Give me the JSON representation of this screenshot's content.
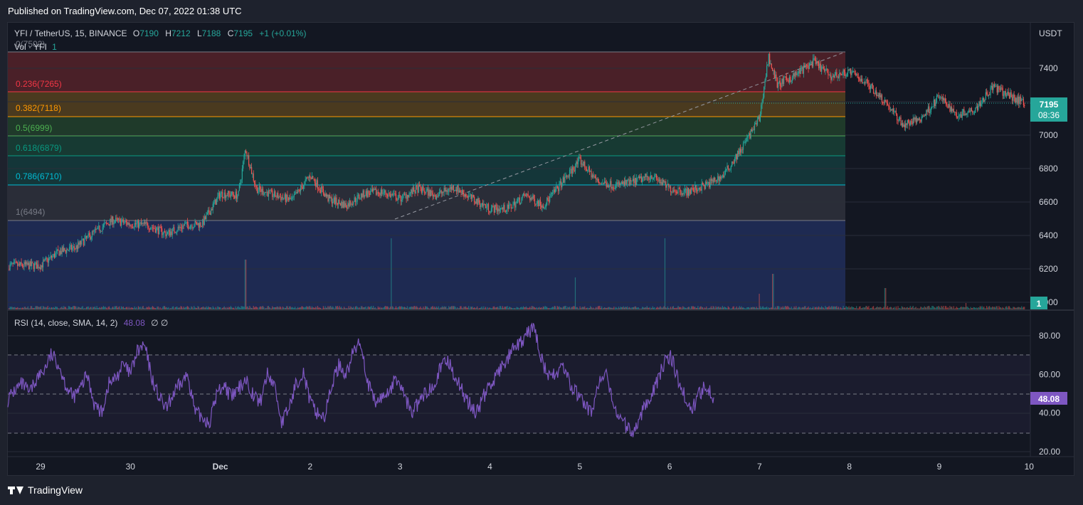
{
  "header": {
    "published_text": "Published on TradingView.com, Dec 07, 2022 01:38 UTC"
  },
  "legend": {
    "symbol": "YFI / TetherUS, 15, BINANCE",
    "o_label": "O",
    "o_value": "7190",
    "h_label": "H",
    "h_value": "7212",
    "l_label": "L",
    "l_value": "7188",
    "c_label": "C",
    "c_value": "7195",
    "change": "+1 (+0.01%)",
    "vol_label": "Vol · YFI",
    "vol_value": "1"
  },
  "price_axis": {
    "currency": "USDT",
    "ticks": [
      "7400",
      "7200",
      "7000",
      "6800",
      "6600",
      "6400",
      "6200",
      "6000"
    ],
    "last_price": "7195",
    "countdown": "08:36",
    "vol_badge": "1"
  },
  "rsi_panel": {
    "label": "RSI (14, close, SMA, 14, 2)",
    "value": "48.08",
    "extra": "∅ ∅",
    "ticks": [
      "80.00",
      "60.00",
      "40.00",
      "20.00"
    ],
    "badge": "48.08"
  },
  "time_axis": {
    "labels": [
      "29",
      "30",
      "Dec",
      "2",
      "3",
      "4",
      "5",
      "6",
      "7",
      "8",
      "9",
      "10"
    ]
  },
  "footer": {
    "brand": "TradingView"
  },
  "colors": {
    "up": "#26a69a",
    "down": "#ef5350",
    "rsi": "#7e57c2",
    "background": "#131722"
  },
  "chart_data": [
    {
      "type": "candlestick",
      "title": "YFI / TetherUS, 15, BINANCE",
      "x_labels": [
        "29",
        "30",
        "Dec",
        "2",
        "3",
        "4",
        "5",
        "6",
        "7",
        "8",
        "9",
        "10"
      ],
      "ylim": [
        6050,
        7520
      ],
      "y_ticks": [
        6200,
        6400,
        6600,
        6800,
        7000,
        7200,
        7400
      ],
      "fib_levels": [
        {
          "label": "0(7502)",
          "ratio": 0,
          "price": 7502,
          "color": "#787b86"
        },
        {
          "label": "0.236(7265)",
          "ratio": 0.236,
          "price": 7265,
          "color": "#f23645"
        },
        {
          "label": "0.382(7118)",
          "ratio": 0.382,
          "price": 7118,
          "color": "#ff9800"
        },
        {
          "label": "0.5(6999)",
          "ratio": 0.5,
          "price": 6999,
          "color": "#4caf50"
        },
        {
          "label": "0.618(6879)",
          "ratio": 0.618,
          "price": 6879,
          "color": "#089981"
        },
        {
          "label": "0.786(6710)",
          "ratio": 0.786,
          "price": 6710,
          "color": "#00bcd4"
        },
        {
          "label": "1(6494)",
          "ratio": 1,
          "price": 6494,
          "color": "#787b86"
        }
      ],
      "price_path": [
        {
          "t": 0.0,
          "p": 6220
        },
        {
          "t": 0.2,
          "p": 6300
        },
        {
          "t": 0.4,
          "p": 6330
        },
        {
          "t": 0.6,
          "p": 6420
        },
        {
          "t": 0.8,
          "p": 6490
        },
        {
          "t": 1.0,
          "p": 6470
        },
        {
          "t": 1.2,
          "p": 6460
        },
        {
          "t": 1.4,
          "p": 6410
        },
        {
          "t": 1.6,
          "p": 6460
        },
        {
          "t": 1.8,
          "p": 6470
        },
        {
          "t": 2.0,
          "p": 6650
        },
        {
          "t": 2.2,
          "p": 6640
        },
        {
          "t": 2.28,
          "p": 6920
        },
        {
          "t": 2.4,
          "p": 6680
        },
        {
          "t": 2.6,
          "p": 6640
        },
        {
          "t": 2.8,
          "p": 6610
        },
        {
          "t": 3.0,
          "p": 6760
        },
        {
          "t": 3.2,
          "p": 6620
        },
        {
          "t": 3.4,
          "p": 6580
        },
        {
          "t": 3.6,
          "p": 6650
        },
        {
          "t": 3.8,
          "p": 6660
        },
        {
          "t": 4.0,
          "p": 6620
        },
        {
          "t": 4.2,
          "p": 6680
        },
        {
          "t": 4.4,
          "p": 6640
        },
        {
          "t": 4.6,
          "p": 6690
        },
        {
          "t": 4.8,
          "p": 6620
        },
        {
          "t": 5.0,
          "p": 6560
        },
        {
          "t": 5.2,
          "p": 6560
        },
        {
          "t": 5.4,
          "p": 6640
        },
        {
          "t": 5.6,
          "p": 6580
        },
        {
          "t": 6.0,
          "p": 6850
        },
        {
          "t": 6.2,
          "p": 6720
        },
        {
          "t": 6.4,
          "p": 6700
        },
        {
          "t": 6.6,
          "p": 6720
        },
        {
          "t": 6.8,
          "p": 6760
        },
        {
          "t": 7.0,
          "p": 6680
        },
        {
          "t": 7.2,
          "p": 6660
        },
        {
          "t": 7.4,
          "p": 6700
        },
        {
          "t": 7.6,
          "p": 6760
        },
        {
          "t": 7.8,
          "p": 6920
        },
        {
          "t": 8.0,
          "p": 7100
        },
        {
          "t": 8.1,
          "p": 7470
        },
        {
          "t": 8.2,
          "p": 7300
        },
        {
          "t": 8.4,
          "p": 7360
        },
        {
          "t": 8.6,
          "p": 7440
        },
        {
          "t": 8.8,
          "p": 7350
        },
        {
          "t": 9.0,
          "p": 7380
        },
        {
          "t": 9.2,
          "p": 7310
        },
        {
          "t": 9.4,
          "p": 7200
        },
        {
          "t": 9.6,
          "p": 7060
        },
        {
          "t": 9.8,
          "p": 7100
        },
        {
          "t": 10.0,
          "p": 7230
        },
        {
          "t": 10.2,
          "p": 7120
        },
        {
          "t": 10.4,
          "p": 7160
        },
        {
          "t": 10.6,
          "p": 7290
        },
        {
          "t": 10.8,
          "p": 7230
        },
        {
          "t": 10.95,
          "p": 7195
        }
      ],
      "volume_spikes": [
        {
          "t": 2.28,
          "v": 70
        },
        {
          "t": 3.9,
          "v": 100
        },
        {
          "t": 5.95,
          "v": 45
        },
        {
          "t": 6.95,
          "v": 100
        },
        {
          "t": 8.0,
          "v": 22
        },
        {
          "t": 8.15,
          "v": 50
        },
        {
          "t": 9.4,
          "v": 30
        },
        {
          "t": 10.3,
          "v": 9
        }
      ]
    },
    {
      "type": "line",
      "title": "RSI (14, close, SMA, 14, 2)",
      "ylim": [
        15,
        92
      ],
      "y_ticks": [
        20,
        40,
        60,
        80
      ],
      "bands": [
        70,
        50,
        30
      ],
      "series": [
        {
          "name": "RSI",
          "values": [
            47,
            52,
            55,
            50,
            58,
            62,
            70,
            66,
            55,
            48,
            52,
            60,
            45,
            40,
            55,
            58,
            65,
            60,
            72,
            75,
            58,
            48,
            42,
            50,
            55,
            60,
            40,
            38,
            35,
            50,
            55,
            48,
            52,
            58,
            50,
            45,
            60,
            55,
            35,
            42,
            55,
            62,
            45,
            40,
            38,
            55,
            65,
            60,
            72,
            77,
            55,
            45,
            48,
            52,
            58,
            50,
            40,
            45,
            50,
            55,
            62,
            68,
            60,
            52,
            45,
            40,
            48,
            55,
            60,
            66,
            72,
            75,
            80,
            85,
            70,
            58,
            60,
            65,
            55,
            50,
            45,
            40,
            55,
            60,
            45,
            38,
            32,
            30,
            40,
            48,
            55,
            65,
            70,
            58,
            48,
            42,
            50,
            55,
            48.08
          ]
        }
      ]
    }
  ]
}
